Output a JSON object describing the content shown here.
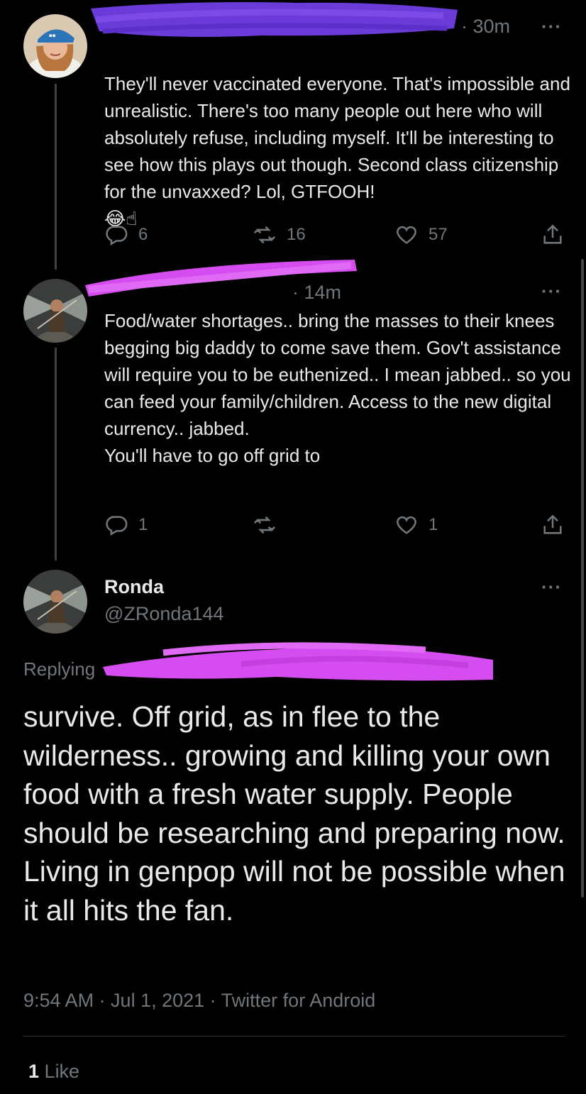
{
  "tweet1": {
    "time": "· 30m",
    "more": "···",
    "text": "They'll never vaccinated everyone. That's impossible and unrealistic. There's too many people out here who will absolutely refuse, including myself. It'll be interesting to see how this plays out though. Second class citizenship for the unvaxxed? Lol, GTFOOH!",
    "emoji": "😂☝",
    "reply_count": "6",
    "retweet_count": "16",
    "like_count": "57"
  },
  "tweet2": {
    "time": "· 14m",
    "more": "···",
    "text": "Food/water shortages.. bring the masses to their knees begging big daddy to come save them. Gov't assistance will require you to be euthenized.. I mean jabbed.. so you can feed your family/children. Access to the new digital currency.. jabbed.\nYou'll have to go off grid to",
    "reply_count": "1",
    "retweet_count": "",
    "like_count": "1"
  },
  "main": {
    "name": "Ronda",
    "handle": "@ZRonda144",
    "more": "···",
    "replying": "Replying",
    "text": "survive. Off grid, as in flee to the wilderness.. growing and killing your own food with a fresh water supply. People should be researching and preparing now.\nLiving in genpop will not be possible when it all hits the fan.",
    "timestamp": "9:54 AM · Jul 1, 2021 · Twitter for Android",
    "likes_number": "1",
    "likes_label": "Like"
  },
  "colors": {
    "background": "#000000",
    "text": "#e7e9ea",
    "secondary": "#71767b",
    "redaction_blue": "#6a3bd9",
    "redaction_pink": "#d54df0"
  },
  "icons": [
    "reply-icon",
    "retweet-icon",
    "like-icon",
    "share-icon"
  ]
}
